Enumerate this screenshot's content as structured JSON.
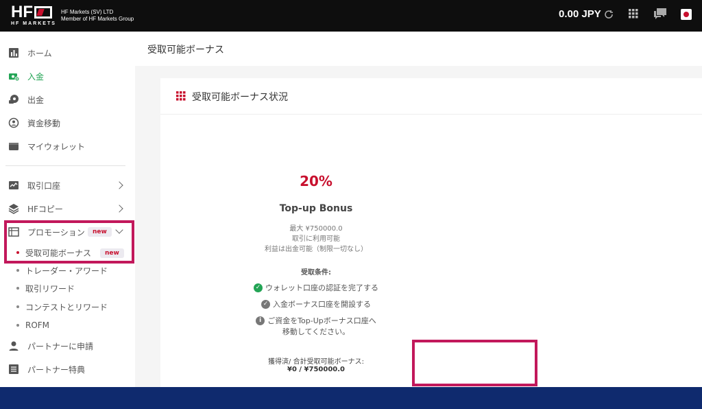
{
  "header": {
    "logo_text": "HF",
    "logo_sub": "HF MARKETS",
    "company_line1": "HF Markets (SV) LTD",
    "company_line2": "Member of HF Markets Group",
    "balance": "0.00 JPY"
  },
  "sidebar": {
    "items": [
      {
        "label": "ホーム",
        "icon": "bar-chart-icon"
      },
      {
        "label": "入金",
        "icon": "deposit-icon"
      },
      {
        "label": "出金",
        "icon": "withdraw-icon"
      },
      {
        "label": "資金移動",
        "icon": "transfer-icon"
      },
      {
        "label": "マイウォレット",
        "icon": "wallet-icon"
      },
      {
        "label": "取引口座",
        "icon": "trading-chart-icon"
      },
      {
        "label": "HFコピー",
        "icon": "layers-icon"
      },
      {
        "label": "プロモーション",
        "icon": "promotion-icon",
        "badge": "new"
      }
    ],
    "sub_items": [
      {
        "label": "受取可能ボーナス",
        "badge": "new"
      },
      {
        "label": "トレーダー・アワード"
      },
      {
        "label": "取引リワード"
      },
      {
        "label": "コンテストとリワード"
      },
      {
        "label": "ROFM"
      }
    ],
    "bottom_items": [
      {
        "label": "パートナーに申請",
        "icon": "person-icon"
      },
      {
        "label": "パートナー特典",
        "icon": "list-icon"
      }
    ]
  },
  "page": {
    "title": "受取可能ボーナス"
  },
  "card": {
    "title": "受取可能ボーナス状況",
    "bonus_percent": "20%",
    "bonus_name": "Top-up Bonus",
    "details": [
      "最大 ¥750000.0",
      "取引に利用可能",
      "利益は出金可能（制限一切なし）"
    ],
    "conditions_title": "受取条件:",
    "conditions": [
      {
        "text": "ウォレット口座の認証を完了する",
        "status": "done"
      },
      {
        "text": "入金ボーナス口座を開設する",
        "status": "done-grey"
      },
      {
        "text": "ご資金をTop-Upボーナス口座へ",
        "status": "info"
      }
    ],
    "condition_line2": "移動してください。",
    "earned_label": "獲得済/ 合計受取可能ボーナス:",
    "earned_value": "¥0 / ¥750000.0"
  },
  "colors": {
    "brand_red": "#c8102e",
    "active_green": "#23a455",
    "highlight": "#c2185b",
    "footer_blue": "#0f2a6e"
  }
}
